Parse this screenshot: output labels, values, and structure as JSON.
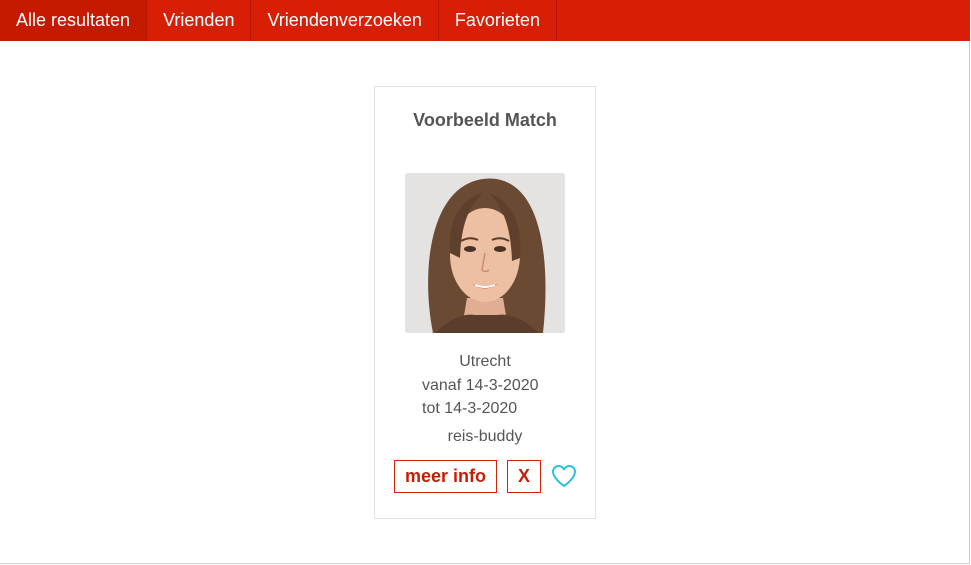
{
  "nav": {
    "tabs": [
      {
        "label": "Alle resultaten",
        "active": true
      },
      {
        "label": "Vrienden"
      },
      {
        "label": "Vriendenverzoeken"
      },
      {
        "label": "Favorieten"
      }
    ]
  },
  "card": {
    "title": "Voorbeeld Match",
    "city": "Utrecht",
    "date_from": "vanaf 14-3-2020",
    "date_to": "tot 14-3-2020",
    "type": "reis-buddy",
    "more_info_label": "meer info",
    "reject_label": "X",
    "favorite_icon": "heart-icon"
  },
  "colors": {
    "brand": "#d81e05",
    "accent": "#29c3d6"
  }
}
